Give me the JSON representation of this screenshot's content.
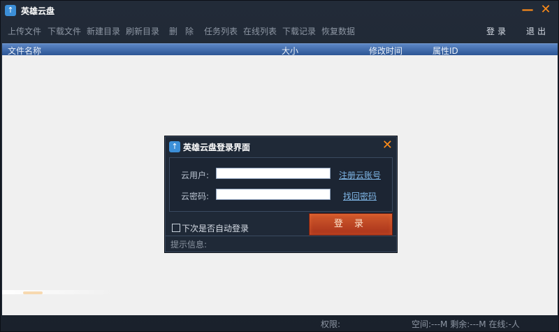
{
  "window": {
    "title": "英雄云盘",
    "icon": "app-upload-icon"
  },
  "toolbar": {
    "items": [
      "上传文件",
      "下载文件",
      "新建目录",
      "刷新目录",
      "删",
      "除",
      "任务列表",
      "在线列表",
      "下载记录",
      "恢复数据"
    ],
    "login": "登录",
    "logout": "退出"
  },
  "list": {
    "columns": [
      "文件名称",
      "大小",
      "修改时间",
      "属性ID"
    ]
  },
  "status": {
    "permission": "权限:",
    "space": "空间:---M 剩余:---M 在线:-人"
  },
  "dialog": {
    "title": "英雄云盘登录界面",
    "user_label": "云用户:",
    "pass_label": "云密码:",
    "register_link": "注册云账号",
    "recover_link": "找回密码",
    "user_value": "",
    "pass_value": "",
    "auto_login": "下次是否自动登录",
    "login_button": "登 录",
    "hint": "提示信息:"
  },
  "colors": {
    "accent_orange": "#ff8c1a",
    "header_blue": "#2c5594",
    "login_red": "#c2462a"
  }
}
